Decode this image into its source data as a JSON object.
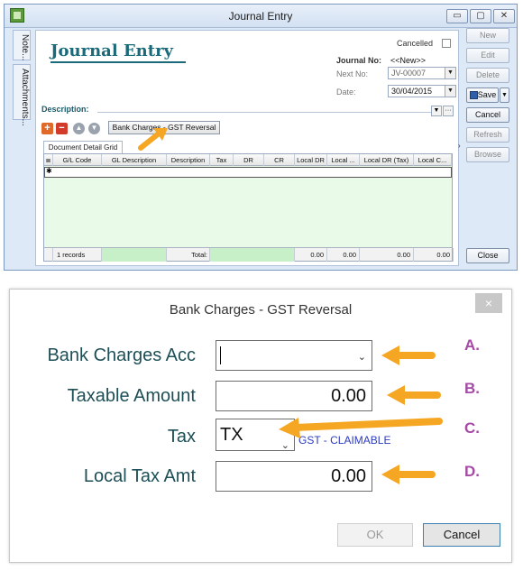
{
  "journal_window": {
    "title": "Journal Entry",
    "side_tabs": [
      "Note...",
      "Attachments..."
    ],
    "heading": "Journal Entry",
    "cancelled_label": "Cancelled",
    "journal_no_label": "Journal No:",
    "journal_no_value": "<<New>>",
    "next_no_label": "Next No:",
    "next_no_value": "JV-00007",
    "date_label": "Date:",
    "date_value": "30/04/2015",
    "description_label": "Description:",
    "bank_charges_button": "Bank Charges - GST Reversal",
    "grid_tab": "Document Detail Grid",
    "grid_columns": [
      "G/L Code",
      "GL Description",
      "Description",
      "Tax",
      "DR",
      "CR",
      "Local DR",
      "Local ...",
      "Local DR (Tax)",
      "Local C..."
    ],
    "footer": {
      "records": "1 records",
      "total_label": "Total:",
      "local_dr": "0.00",
      "local_col": "0.00",
      "local_dr_tax": "0.00",
      "local_c": "0.00"
    },
    "right_buttons": {
      "new": "New",
      "edit": "Edit",
      "delete": "Delete",
      "save": "Save",
      "cancel": "Cancel",
      "refresh": "Refresh",
      "browse": "Browse",
      "close": "Close"
    }
  },
  "dialog": {
    "title": "Bank Charges - GST Reversal",
    "close_glyph": "×",
    "bank_charges_acc_label": "Bank Charges Acc",
    "bank_charges_acc_value": "",
    "taxable_amount_label": "Taxable Amount",
    "taxable_amount_value": "0.00",
    "tax_label": "Tax",
    "tax_value": "TX",
    "tax_description": "GST - CLAIMABLE",
    "local_tax_amt_label": "Local Tax Amt",
    "local_tax_amt_value": "0.00",
    "ok_button": "OK",
    "cancel_button": "Cancel",
    "annotations": [
      "A.",
      "B.",
      "C.",
      "D."
    ]
  },
  "colors": {
    "heading": "#1a6a7a",
    "dialog_label": "#1d4f57",
    "annotation": "#a54aa5",
    "arrow": "#f5a623",
    "grid_bg": "#e9fae9"
  }
}
